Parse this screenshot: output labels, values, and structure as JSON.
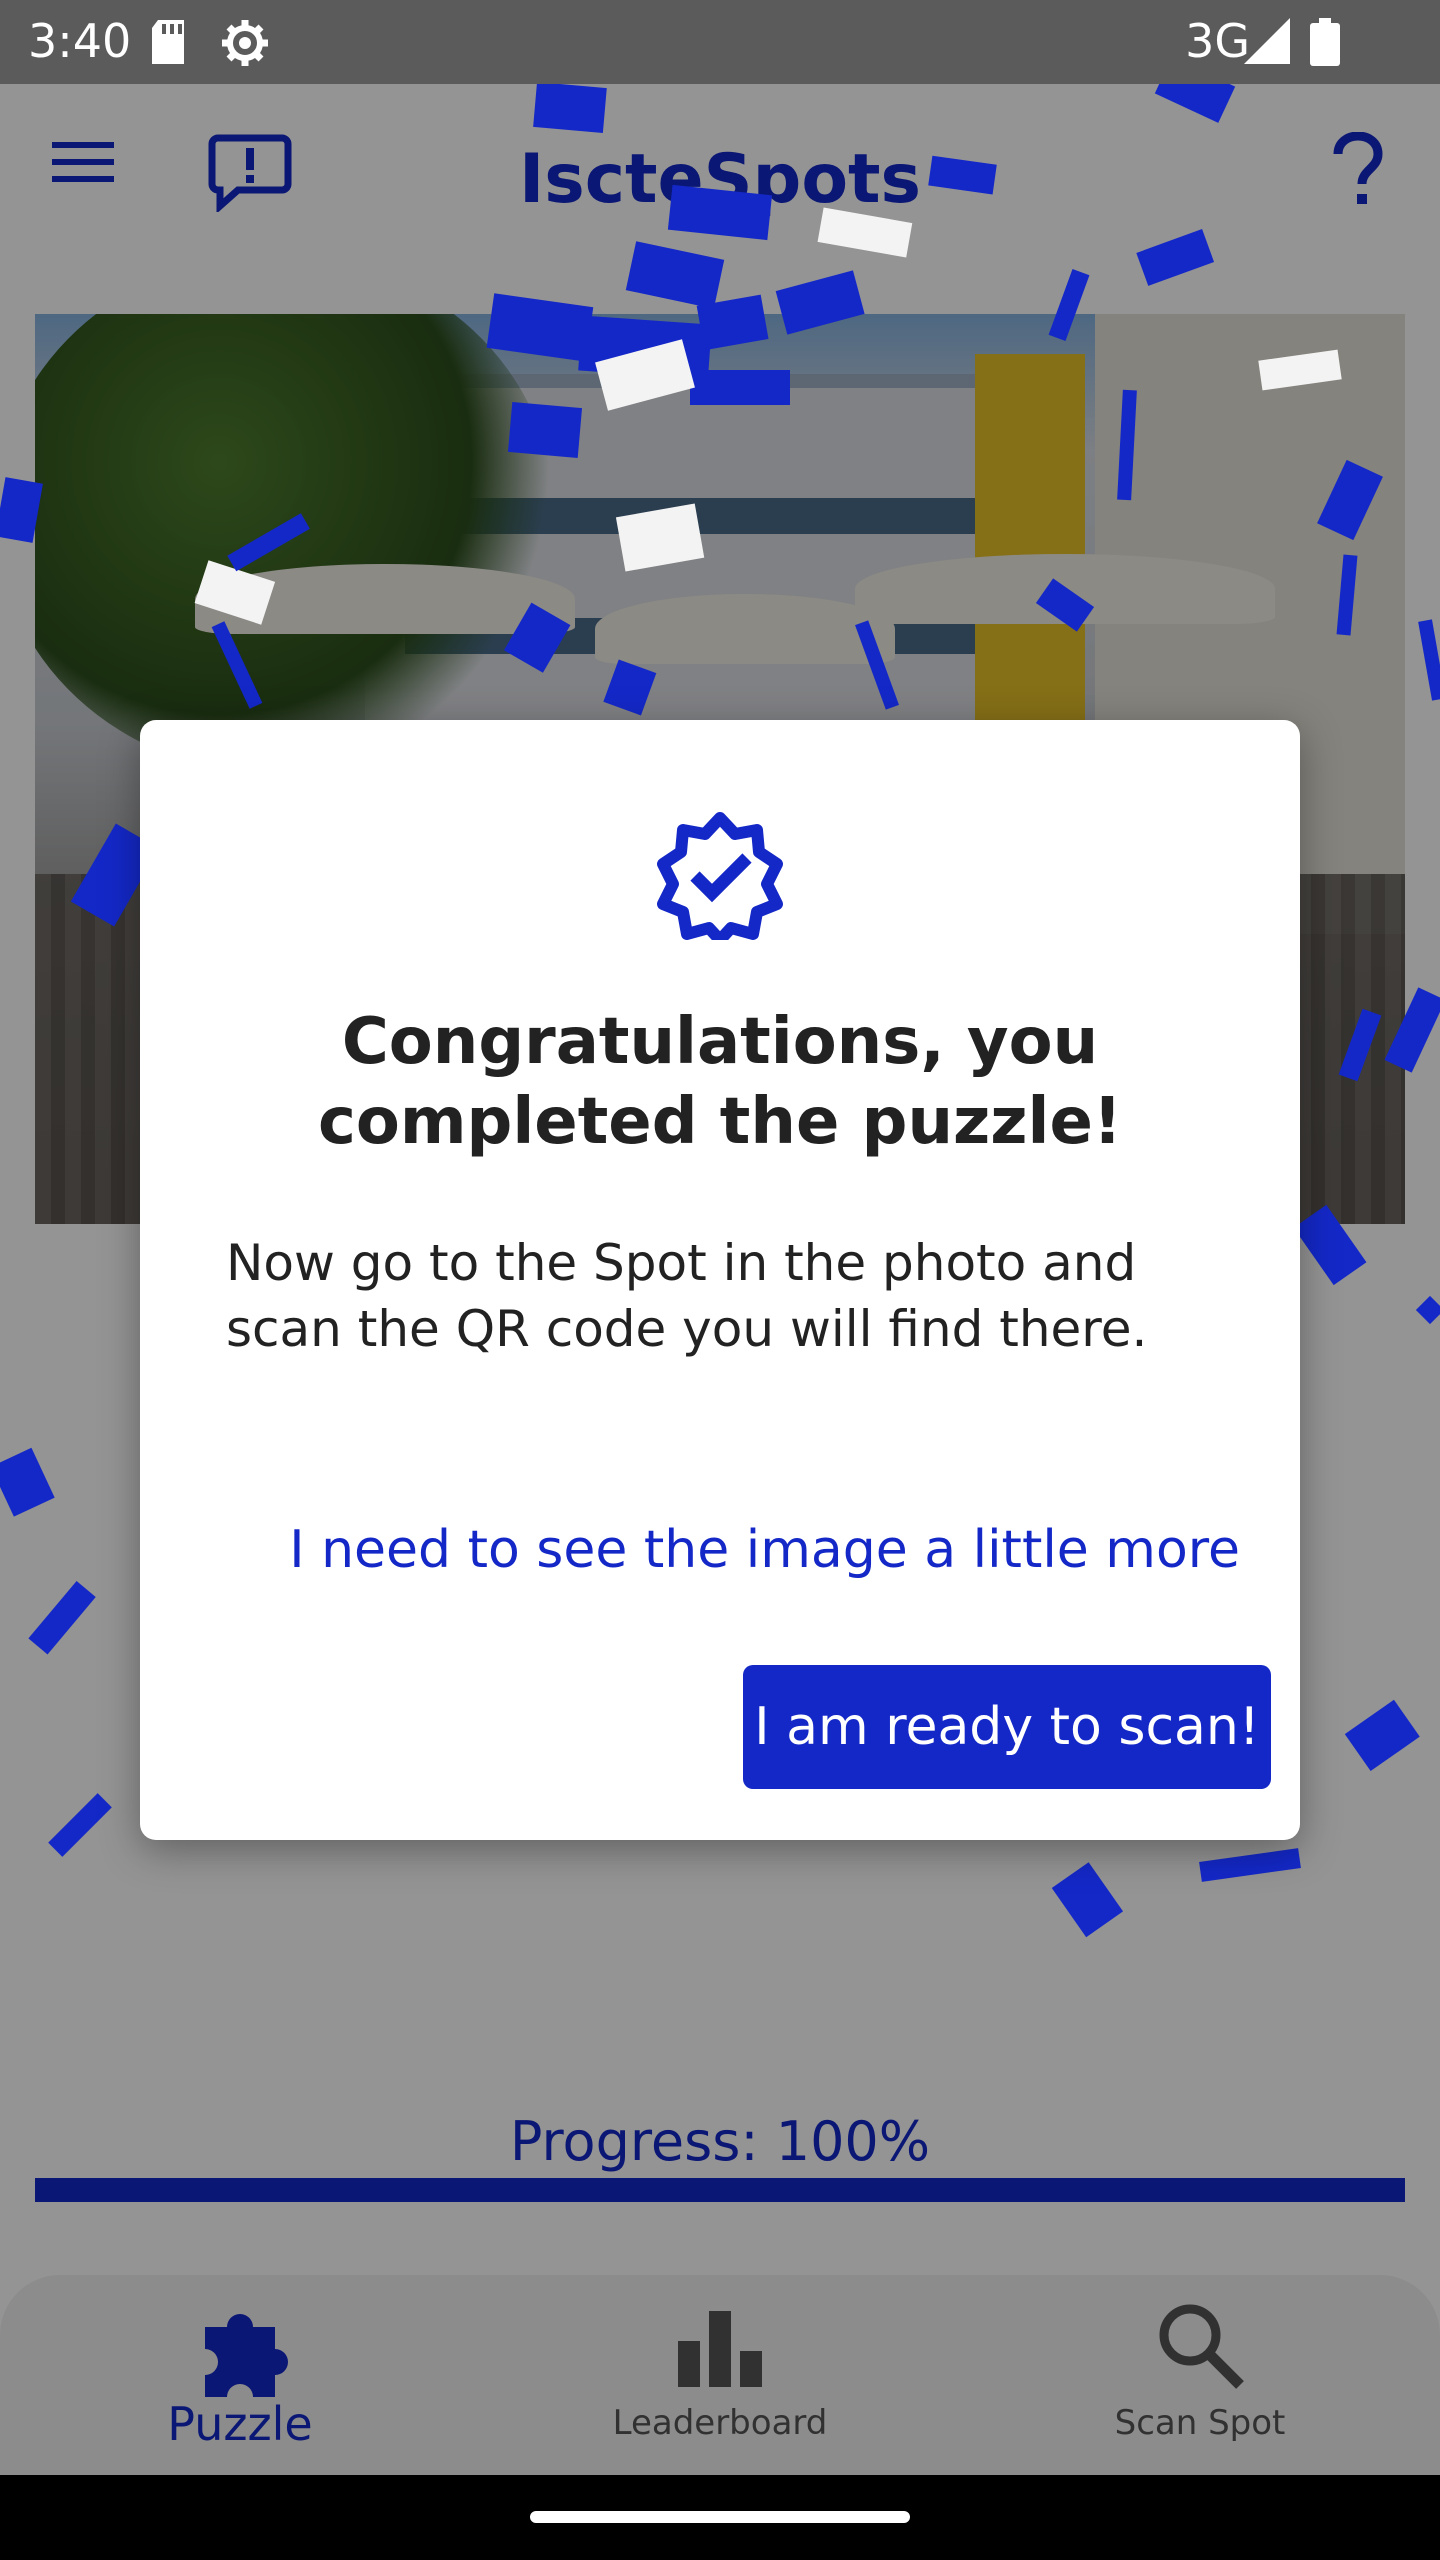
{
  "status_bar": {
    "time": "3:40",
    "network": "3G",
    "icons": [
      "sd-card-icon",
      "settings-gear-icon",
      "signal-icon",
      "battery-icon"
    ]
  },
  "app_bar": {
    "title": "IscteSpots",
    "icons": [
      "menu-icon",
      "feedback-icon",
      "help-icon"
    ]
  },
  "progress": {
    "label": "Progress: 100%",
    "value": 1.0
  },
  "dialog": {
    "title": "Congratulations, you completed the puzzle!",
    "body": "Now go to the Spot in the photo and scan the QR code you will find there.",
    "secondary_button": "I need to see the image a little more",
    "primary_button": "I am ready to scan!",
    "icon": "verified-badge-icon"
  },
  "bottom_nav": {
    "items": [
      {
        "label": "Puzzle",
        "icon": "puzzle-icon",
        "active": true
      },
      {
        "label": "Leaderboard",
        "icon": "leaderboard-icon",
        "active": false
      },
      {
        "label": "Scan Spot",
        "icon": "search-icon",
        "active": false
      }
    ]
  },
  "colors": {
    "accent": "#1428c8",
    "confetti_blue": "#1428c8",
    "confetti_white": "#ffffff"
  }
}
